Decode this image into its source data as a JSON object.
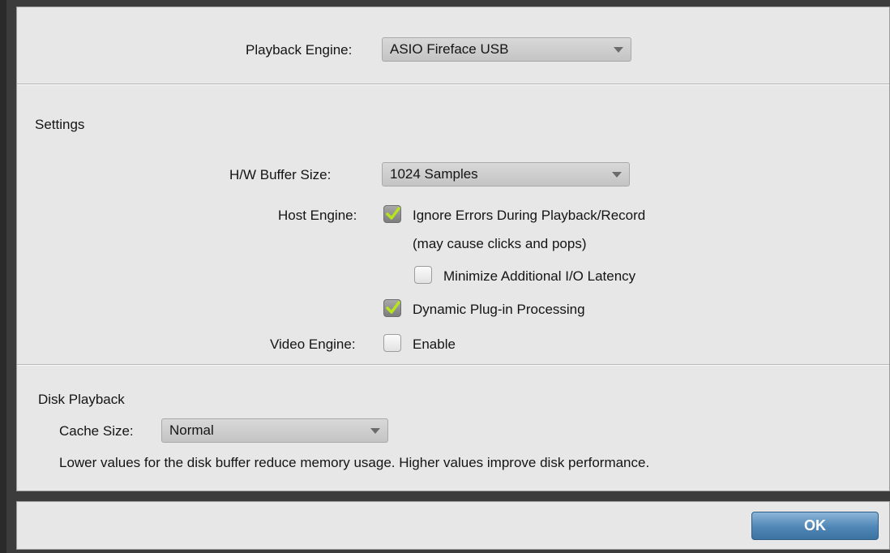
{
  "playback_engine": {
    "label": "Playback Engine:",
    "value": "ASIO Fireface USB"
  },
  "settings": {
    "title": "Settings",
    "buffer_size": {
      "label": "H/W Buffer Size:",
      "value": "1024 Samples"
    },
    "host_engine": {
      "label": "Host Engine:",
      "ignore_errors": {
        "label": "Ignore Errors During Playback/Record",
        "checked": true
      },
      "ignore_errors_note": "(may cause clicks and pops)",
      "minimize_latency": {
        "label": "Minimize Additional I/O Latency",
        "checked": false
      },
      "dynamic_plugin": {
        "label": "Dynamic Plug-in Processing",
        "checked": true
      }
    },
    "video_engine": {
      "label": "Video Engine:",
      "enable": {
        "label": "Enable",
        "checked": false
      }
    }
  },
  "disk_playback": {
    "title": "Disk Playback",
    "cache_size": {
      "label": "Cache Size:",
      "value": "Normal"
    },
    "note": "Lower values for the disk buffer reduce memory usage.  Higher values improve disk performance."
  },
  "footer": {
    "ok_label": "OK"
  },
  "colors": {
    "panel_bg": "#e7e7e7",
    "frame_bg": "#3c3c3c",
    "checkmark": "#b6e51e",
    "ok_button": "#4f86b6"
  }
}
